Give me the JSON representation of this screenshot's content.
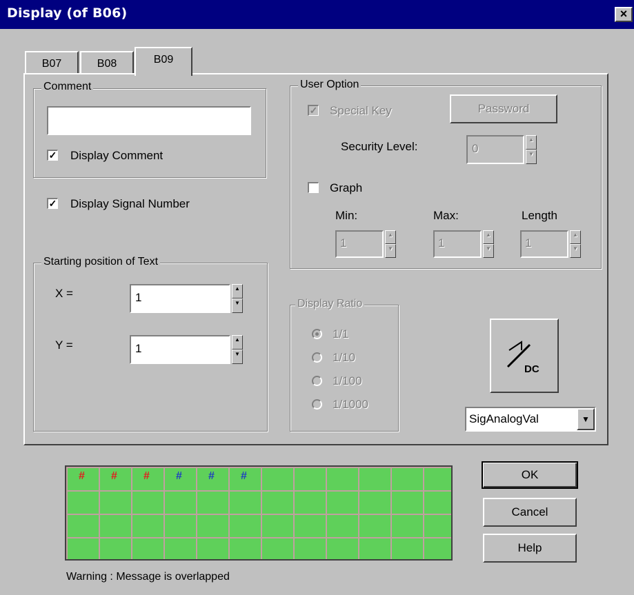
{
  "window": {
    "title": "Display (of B06)",
    "close_glyph": "×"
  },
  "tabs": [
    {
      "label": "B07",
      "active": false
    },
    {
      "label": "B08",
      "active": false
    },
    {
      "label": "B09",
      "active": true
    }
  ],
  "comment_group": {
    "legend": "Comment",
    "value": "",
    "display_comment_label": "Display Comment",
    "display_comment_checked": true
  },
  "display_signal_number": {
    "label": "Display Signal Number",
    "checked": true
  },
  "start_pos_group": {
    "legend": "Starting position of Text",
    "x_label": "X =",
    "x_value": "1",
    "y_label": "Y =",
    "y_value": "1"
  },
  "user_option": {
    "legend": "User Option",
    "special_key_label": "Special Key",
    "special_key_checked": true,
    "password_label": "Password",
    "security_level_label": "Security Level:",
    "security_level_value": "0",
    "graph_label": "Graph",
    "graph_checked": false,
    "min_label": "Min:",
    "min_value": "1",
    "max_label": "Max:",
    "max_value": "1",
    "length_label": "Length",
    "length_value": "1"
  },
  "display_ratio": {
    "legend": "Display Ratio",
    "options": [
      "1/1",
      "1/10",
      "1/100",
      "1/1000"
    ],
    "selected": "1/1"
  },
  "signal_type": {
    "icon_name": "analog-dc-icon",
    "icon_text": "DC",
    "selected": "SigAnalogVal"
  },
  "preview": {
    "markers": [
      {
        "char": "#",
        "color": "#e02020"
      },
      {
        "char": "#",
        "color": "#e02020"
      },
      {
        "char": "#",
        "color": "#e02020"
      },
      {
        "char": "#",
        "color": "#2040c0"
      },
      {
        "char": "#",
        "color": "#2040c0"
      },
      {
        "char": "#",
        "color": "#2040c0"
      }
    ],
    "background_color": "#5fd05a"
  },
  "buttons": {
    "ok": "OK",
    "cancel": "Cancel",
    "help": "Help"
  },
  "warning": "Warning : Message is overlapped"
}
